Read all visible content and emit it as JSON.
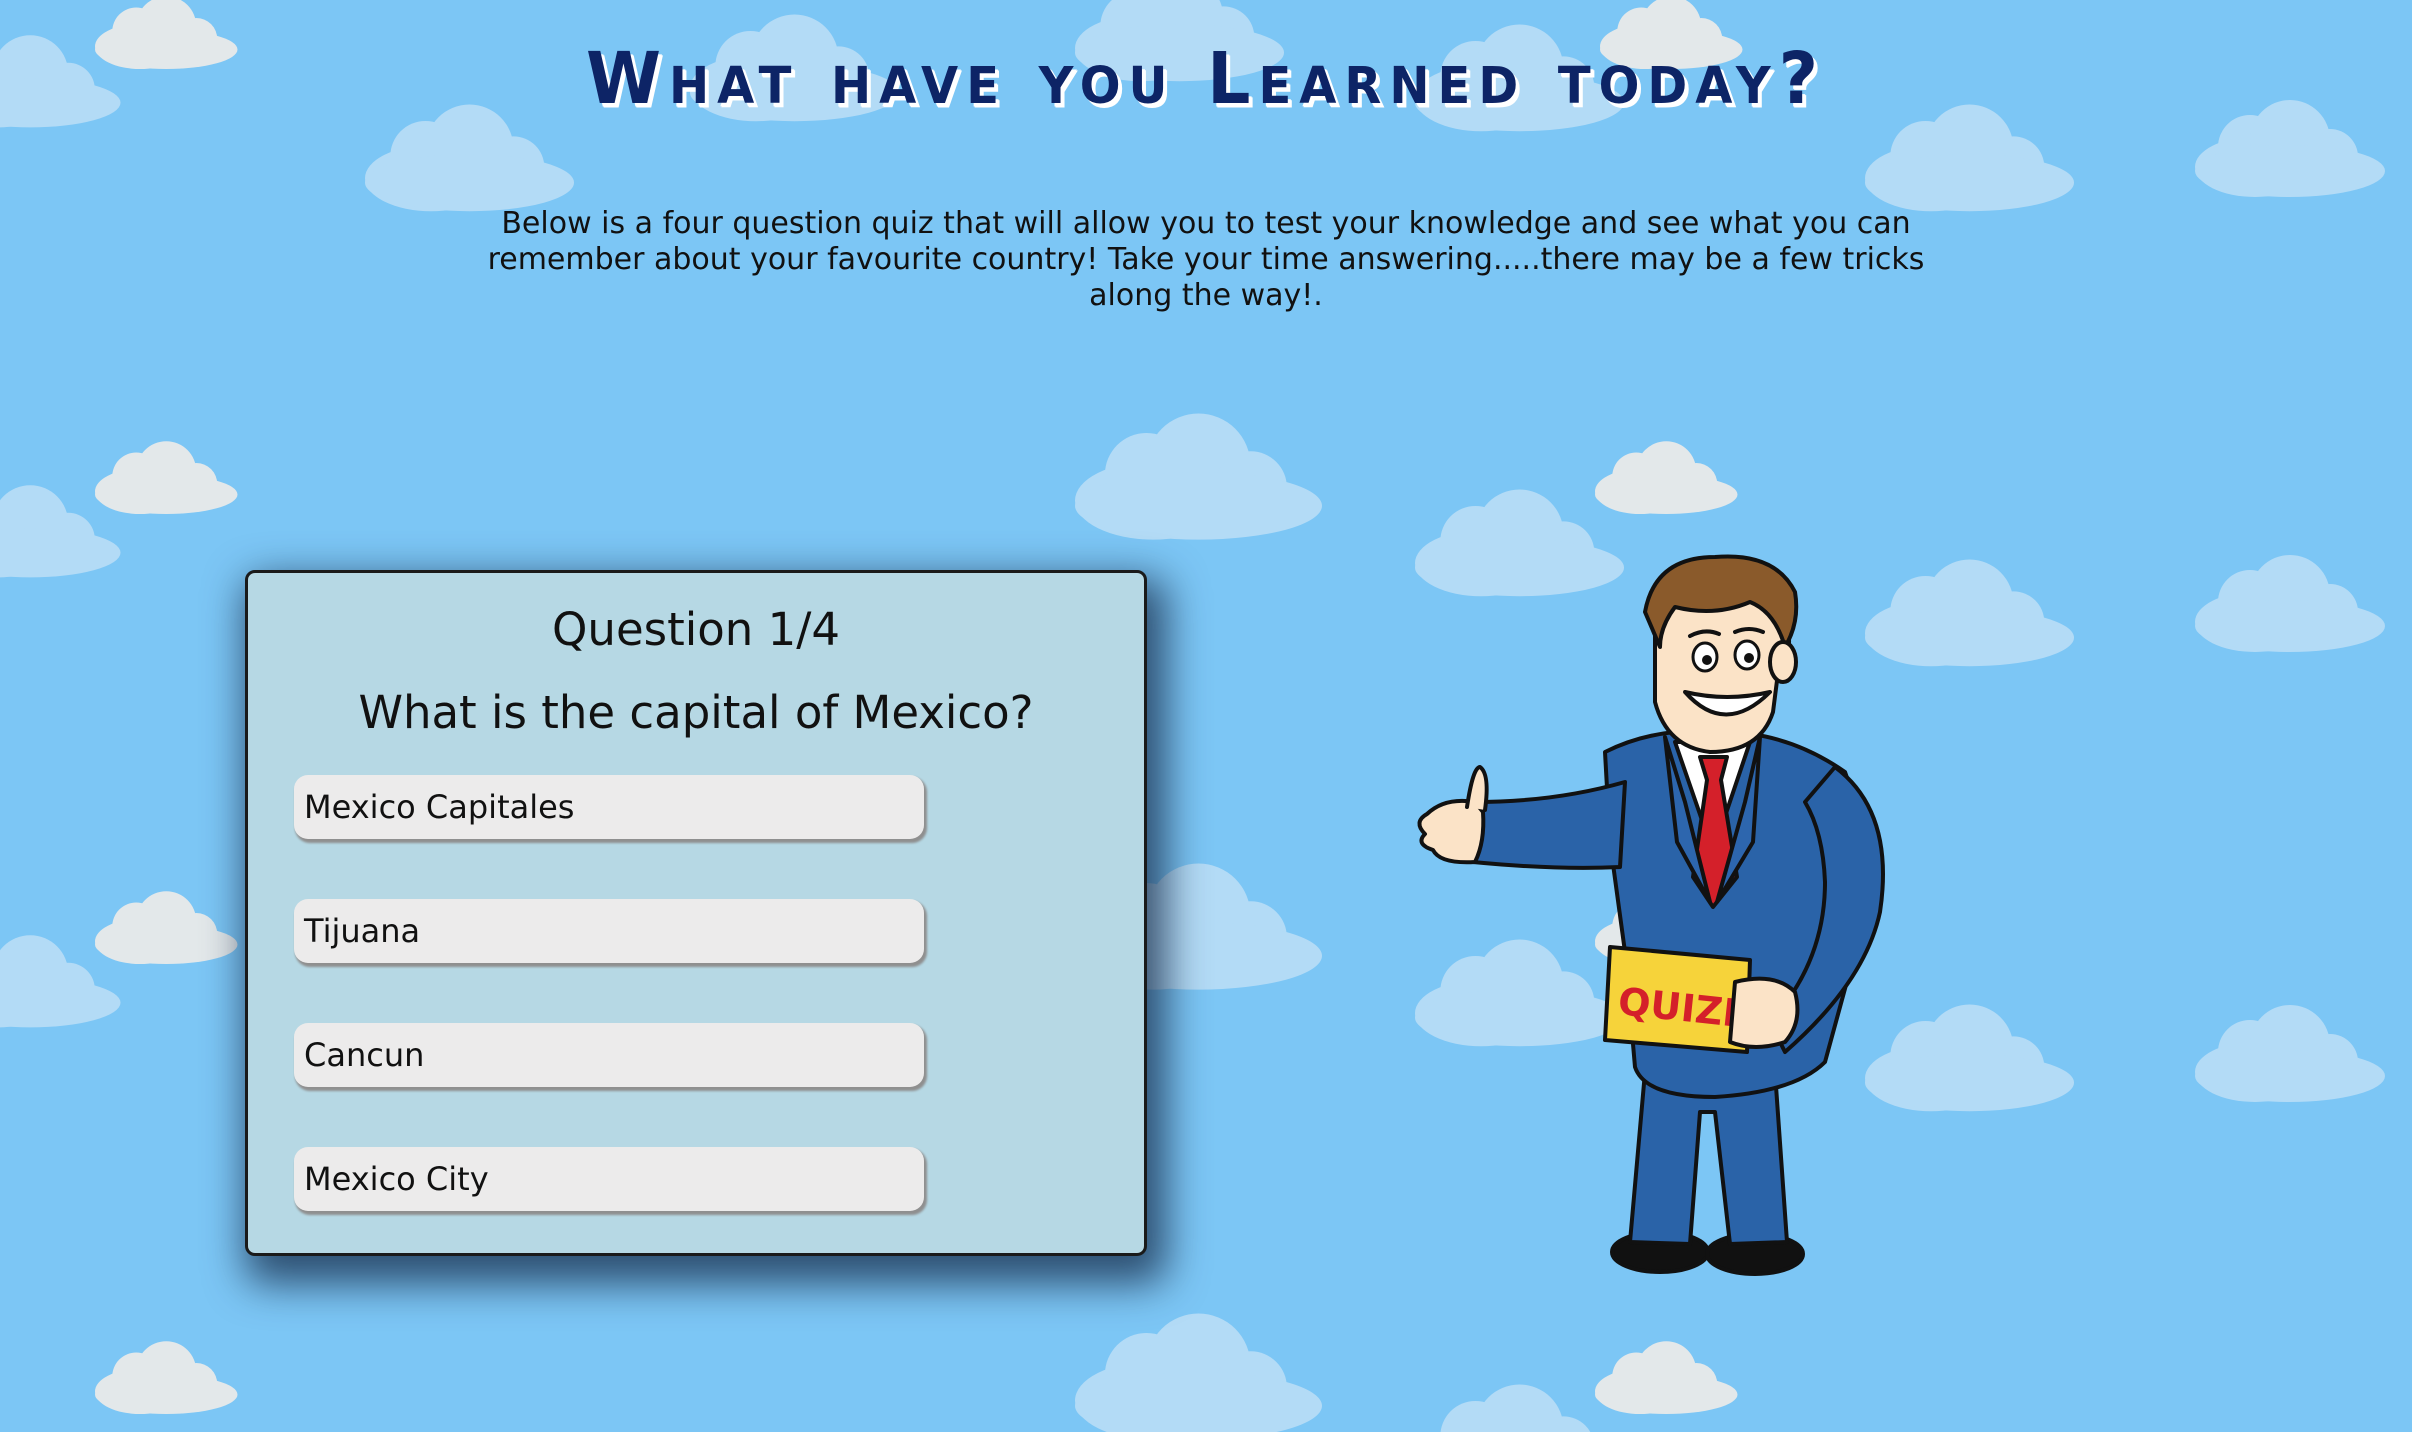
{
  "header": {
    "title": "What have you Learned today?",
    "intro": "Below is a four question quiz that will allow you to test your knowledge and see what you can remember about your favourite country! Take your time answering.....there may be a few tricks along the way!."
  },
  "quiz": {
    "question_number": "Question 1/4",
    "question_text": "What is the capital of Mexico?",
    "answers": [
      {
        "label": "Mexico Capitales"
      },
      {
        "label": "Tijuana"
      },
      {
        "label": "Cancun"
      },
      {
        "label": "Mexico City"
      }
    ]
  },
  "illustration": {
    "host_card_text": "QUIZM",
    "icon": "quiz-host-character"
  },
  "colors": {
    "background": "#7cc6f5",
    "title": "#0d2466",
    "card": "#b6d8e4",
    "answer": "#ecebeb",
    "suit": "#2a63a8"
  }
}
